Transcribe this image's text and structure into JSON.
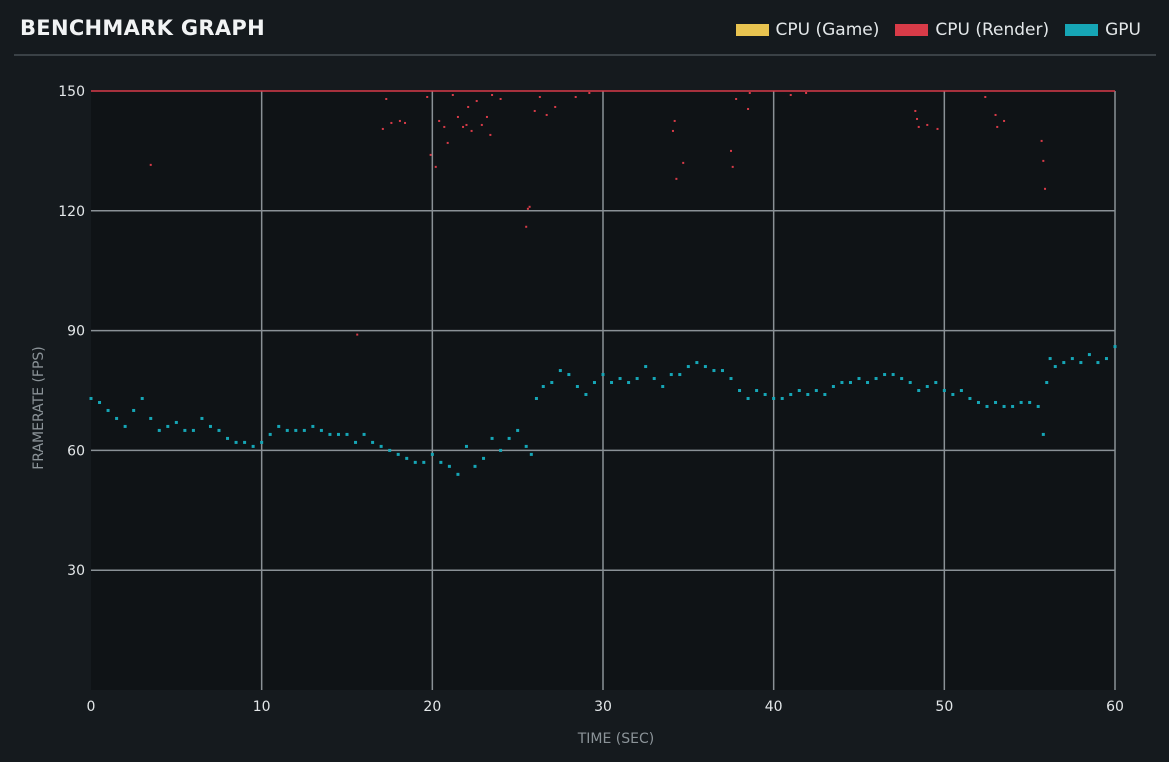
{
  "header": {
    "title": "BENCHMARK GRAPH"
  },
  "legend": [
    {
      "label": "CPU (Game)",
      "color": "#e8c350"
    },
    {
      "label": "CPU (Render)",
      "color": "#d83b48"
    },
    {
      "label": "GPU",
      "color": "#16a6b6"
    }
  ],
  "chart_data": {
    "type": "scatter",
    "title": "BENCHMARK GRAPH",
    "xlabel": "TIME (SEC)",
    "ylabel": "FRAMERATE (FPS)",
    "xlim": [
      0,
      60
    ],
    "ylim": [
      0,
      150
    ],
    "xticks": [
      0,
      10,
      20,
      30,
      40,
      50,
      60
    ],
    "yticks": [
      30,
      60,
      90,
      120,
      150
    ],
    "grid": true,
    "legend_position": "top-right",
    "cap_line": {
      "value": 150,
      "color": "#d83b48"
    },
    "series": [
      {
        "name": "CPU (Game)",
        "color": "#e8c350",
        "points": []
      },
      {
        "name": "CPU (Render)",
        "color": "#d83b48",
        "points": [
          [
            3.5,
            131.5
          ],
          [
            15.6,
            89
          ],
          [
            17.1,
            140.5
          ],
          [
            17.3,
            148
          ],
          [
            17.6,
            142
          ],
          [
            18.1,
            142.5
          ],
          [
            18.4,
            142
          ],
          [
            19.7,
            148.5
          ],
          [
            19.9,
            134
          ],
          [
            20.2,
            131
          ],
          [
            20.4,
            142.5
          ],
          [
            20.7,
            141
          ],
          [
            20.9,
            137
          ],
          [
            21.2,
            149
          ],
          [
            21.5,
            143.5
          ],
          [
            21.8,
            141
          ],
          [
            22.0,
            141.5
          ],
          [
            22.1,
            146
          ],
          [
            22.3,
            140
          ],
          [
            22.6,
            147.5
          ],
          [
            22.9,
            141.5
          ],
          [
            23.2,
            143.5
          ],
          [
            23.4,
            139
          ],
          [
            23.5,
            149
          ],
          [
            24.0,
            148
          ],
          [
            25.5,
            116
          ],
          [
            25.6,
            120.5
          ],
          [
            25.7,
            121
          ],
          [
            26.0,
            145
          ],
          [
            26.3,
            148.5
          ],
          [
            26.7,
            144
          ],
          [
            27.2,
            146
          ],
          [
            28.4,
            148.5
          ],
          [
            29.2,
            149.5
          ],
          [
            34.1,
            140
          ],
          [
            34.2,
            142.5
          ],
          [
            34.3,
            128
          ],
          [
            34.7,
            132
          ],
          [
            37.5,
            135
          ],
          [
            37.6,
            131
          ],
          [
            37.8,
            148
          ],
          [
            38.5,
            145.5
          ],
          [
            38.6,
            149.5
          ],
          [
            41.0,
            149
          ],
          [
            41.9,
            149.5
          ],
          [
            48.3,
            145
          ],
          [
            48.4,
            143
          ],
          [
            48.5,
            141
          ],
          [
            49.0,
            141.5
          ],
          [
            49.6,
            140.5
          ],
          [
            52.4,
            148.5
          ],
          [
            53.0,
            144
          ],
          [
            53.1,
            141
          ],
          [
            53.5,
            142.5
          ],
          [
            55.7,
            137.5
          ],
          [
            55.8,
            132.5
          ],
          [
            55.9,
            125.5
          ]
        ]
      },
      {
        "name": "GPU",
        "color": "#16a6b6",
        "points": [
          [
            0,
            73
          ],
          [
            0.5,
            72
          ],
          [
            1,
            70
          ],
          [
            1.5,
            68
          ],
          [
            2,
            66
          ],
          [
            2.5,
            70
          ],
          [
            3,
            73
          ],
          [
            3.5,
            68
          ],
          [
            4,
            65
          ],
          [
            4.5,
            66
          ],
          [
            5,
            67
          ],
          [
            5.5,
            65
          ],
          [
            6,
            65
          ],
          [
            6.5,
            68
          ],
          [
            7,
            66
          ],
          [
            7.5,
            65
          ],
          [
            8,
            63
          ],
          [
            8.5,
            62
          ],
          [
            9,
            62
          ],
          [
            9.5,
            61
          ],
          [
            10,
            62
          ],
          [
            10.5,
            64
          ],
          [
            11,
            66
          ],
          [
            11.5,
            65
          ],
          [
            12,
            65
          ],
          [
            12.5,
            65
          ],
          [
            13,
            66
          ],
          [
            13.5,
            65
          ],
          [
            14,
            64
          ],
          [
            14.5,
            64
          ],
          [
            15,
            64
          ],
          [
            15.5,
            62
          ],
          [
            16,
            64
          ],
          [
            16.5,
            62
          ],
          [
            17,
            61
          ],
          [
            17.5,
            60
          ],
          [
            18,
            59
          ],
          [
            18.5,
            58
          ],
          [
            19,
            57
          ],
          [
            19.5,
            57
          ],
          [
            20,
            59
          ],
          [
            20.5,
            57
          ],
          [
            21,
            56
          ],
          [
            21.5,
            54
          ],
          [
            22,
            61
          ],
          [
            22.5,
            56
          ],
          [
            23,
            58
          ],
          [
            23.5,
            63
          ],
          [
            24,
            60
          ],
          [
            24.5,
            63
          ],
          [
            25,
            65
          ],
          [
            25.5,
            61
          ],
          [
            25.8,
            59
          ],
          [
            26.1,
            73
          ],
          [
            26.5,
            76
          ],
          [
            27,
            77
          ],
          [
            27.5,
            80
          ],
          [
            28,
            79
          ],
          [
            28.5,
            76
          ],
          [
            29,
            74
          ],
          [
            29.5,
            77
          ],
          [
            30,
            79
          ],
          [
            30.5,
            77
          ],
          [
            31,
            78
          ],
          [
            31.5,
            77
          ],
          [
            32,
            78
          ],
          [
            32.5,
            81
          ],
          [
            33,
            78
          ],
          [
            33.5,
            76
          ],
          [
            34,
            79
          ],
          [
            34.5,
            79
          ],
          [
            35,
            81
          ],
          [
            35.5,
            82
          ],
          [
            36,
            81
          ],
          [
            36.5,
            80
          ],
          [
            37,
            80
          ],
          [
            37.5,
            78
          ],
          [
            38,
            75
          ],
          [
            38.5,
            73
          ],
          [
            39,
            75
          ],
          [
            39.5,
            74
          ],
          [
            40,
            73
          ],
          [
            40.5,
            73
          ],
          [
            41,
            74
          ],
          [
            41.5,
            75
          ],
          [
            42,
            74
          ],
          [
            42.5,
            75
          ],
          [
            43,
            74
          ],
          [
            43.5,
            76
          ],
          [
            44,
            77
          ],
          [
            44.5,
            77
          ],
          [
            45,
            78
          ],
          [
            45.5,
            77
          ],
          [
            46,
            78
          ],
          [
            46.5,
            79
          ],
          [
            47,
            79
          ],
          [
            47.5,
            78
          ],
          [
            48,
            77
          ],
          [
            48.5,
            75
          ],
          [
            49,
            76
          ],
          [
            49.5,
            77
          ],
          [
            50,
            75
          ],
          [
            50.5,
            74
          ],
          [
            51,
            75
          ],
          [
            51.5,
            73
          ],
          [
            52,
            72
          ],
          [
            52.5,
            71
          ],
          [
            53,
            72
          ],
          [
            53.5,
            71
          ],
          [
            54,
            71
          ],
          [
            54.5,
            72
          ],
          [
            55,
            72
          ],
          [
            55.5,
            71
          ],
          [
            55.8,
            64
          ],
          [
            56,
            77
          ],
          [
            56.2,
            83
          ],
          [
            56.5,
            81
          ],
          [
            57,
            82
          ],
          [
            57.5,
            83
          ],
          [
            58,
            82
          ],
          [
            58.5,
            84
          ],
          [
            59,
            82
          ],
          [
            59.5,
            83
          ],
          [
            60,
            86
          ]
        ]
      }
    ]
  }
}
